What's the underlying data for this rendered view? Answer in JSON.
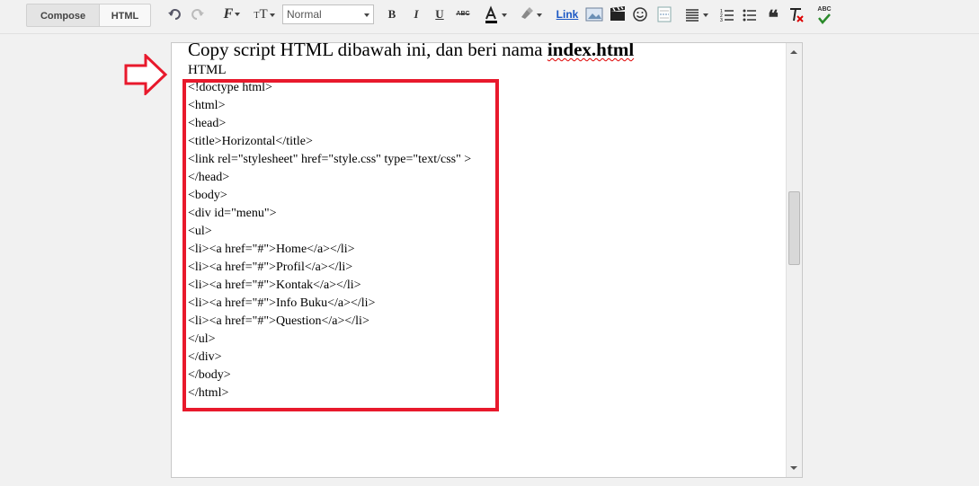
{
  "toolbar": {
    "compose_label": "Compose",
    "html_label": "HTML",
    "font_select_value": "Normal",
    "link_label": "Link",
    "spell_label": "ABC",
    "colors": {
      "link": "#1a57c4",
      "spellcheck": "#2a8a2a"
    }
  },
  "editor": {
    "heading_prefix": "Copy script HTML dibawah ini, dan beri nama ",
    "heading_bold": "index.html",
    "subheading": "HTML",
    "code_lines": [
      "<!doctype html>",
      "<html>",
      "<head>",
      "<title>Horizontal</title>",
      "<link rel=\"stylesheet\" href=\"style.css\" type=\"text/css\" >",
      "</head>",
      "<body>",
      "<div id=\"menu\">",
      "<ul>",
      "<li><a href=\"#\">Home</a></li>",
      "<li><a href=\"#\">Profil</a></li>",
      "<li><a href=\"#\">Kontak</a></li>",
      "<li><a href=\"#\">Info Buku</a></li>",
      "<li><a href=\"#\">Question</a></li>",
      "</ul>",
      "</div>",
      "</body>",
      "</html>"
    ],
    "annotation_color": "#e8192c"
  }
}
